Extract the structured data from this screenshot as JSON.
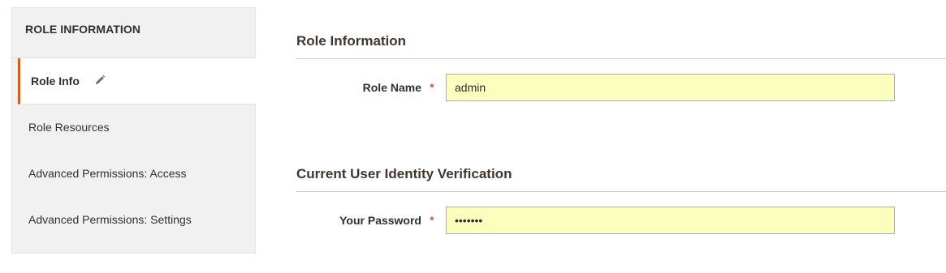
{
  "sidebar": {
    "title": "ROLE INFORMATION",
    "items": [
      {
        "label": "Role Info",
        "active": true,
        "icon": "pencil-icon"
      },
      {
        "label": "Role Resources",
        "active": false
      },
      {
        "label": "Advanced Permissions: Access",
        "active": false
      },
      {
        "label": "Advanced Permissions: Settings",
        "active": false
      }
    ]
  },
  "role_info": {
    "title": "Role Information",
    "role_name": {
      "label": "Role Name",
      "required_mark": "*",
      "value": "admin"
    }
  },
  "verification": {
    "title": "Current User Identity Verification",
    "password": {
      "label": "Your Password",
      "required_mark": "*",
      "value": "•••••••"
    }
  },
  "colors": {
    "accent": "#eb5202",
    "required": "#e22626",
    "autofill_background": "#faffbd",
    "sidebar_background": "#f1f1f1"
  }
}
